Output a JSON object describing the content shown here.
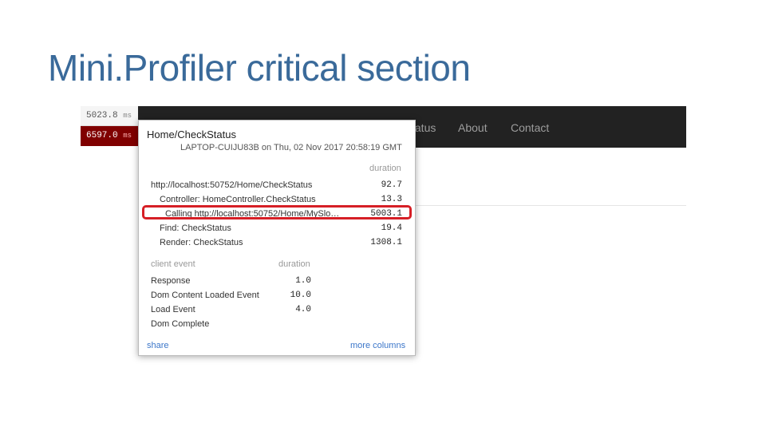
{
  "slide": {
    "title": "Mini.Profiler critical section"
  },
  "navbar": {
    "items": [
      "tatus",
      "About",
      "Contact"
    ]
  },
  "badges": [
    {
      "value": "5023.8",
      "unit": "ms"
    },
    {
      "value": "6597.0",
      "unit": "ms"
    }
  ],
  "profiler": {
    "title": "Home/CheckStatus",
    "machine": "LAPTOP-CUIJU83B on Thu, 02 Nov 2017 20:58:19 GMT",
    "duration_header": "duration",
    "timings": [
      {
        "label": "http://localhost:50752/Home/CheckStatus",
        "value": "92.7",
        "indent": 0
      },
      {
        "label": "Controller: HomeController.CheckStatus",
        "value": "13.3",
        "indent": 1
      },
      {
        "label": "Calling http://localhost:50752/Home/MySlo…",
        "value": "5003.1",
        "indent": 2,
        "highlighted": true
      },
      {
        "label": "Find: CheckStatus",
        "value": "19.4",
        "indent": 1
      },
      {
        "label": "Render: CheckStatus",
        "value": "1308.1",
        "indent": 1
      }
    ],
    "client_header": "client event",
    "client_duration_header": "duration",
    "client_events": [
      {
        "label": "Response",
        "value": "1.0"
      },
      {
        "label": "Dom Content Loaded Event",
        "value": "10.0"
      },
      {
        "label": "Load Event",
        "value": "4.0"
      },
      {
        "label": "Dom Complete",
        "value": ""
      }
    ],
    "share_label": "share",
    "more_columns_label": "more columns"
  }
}
